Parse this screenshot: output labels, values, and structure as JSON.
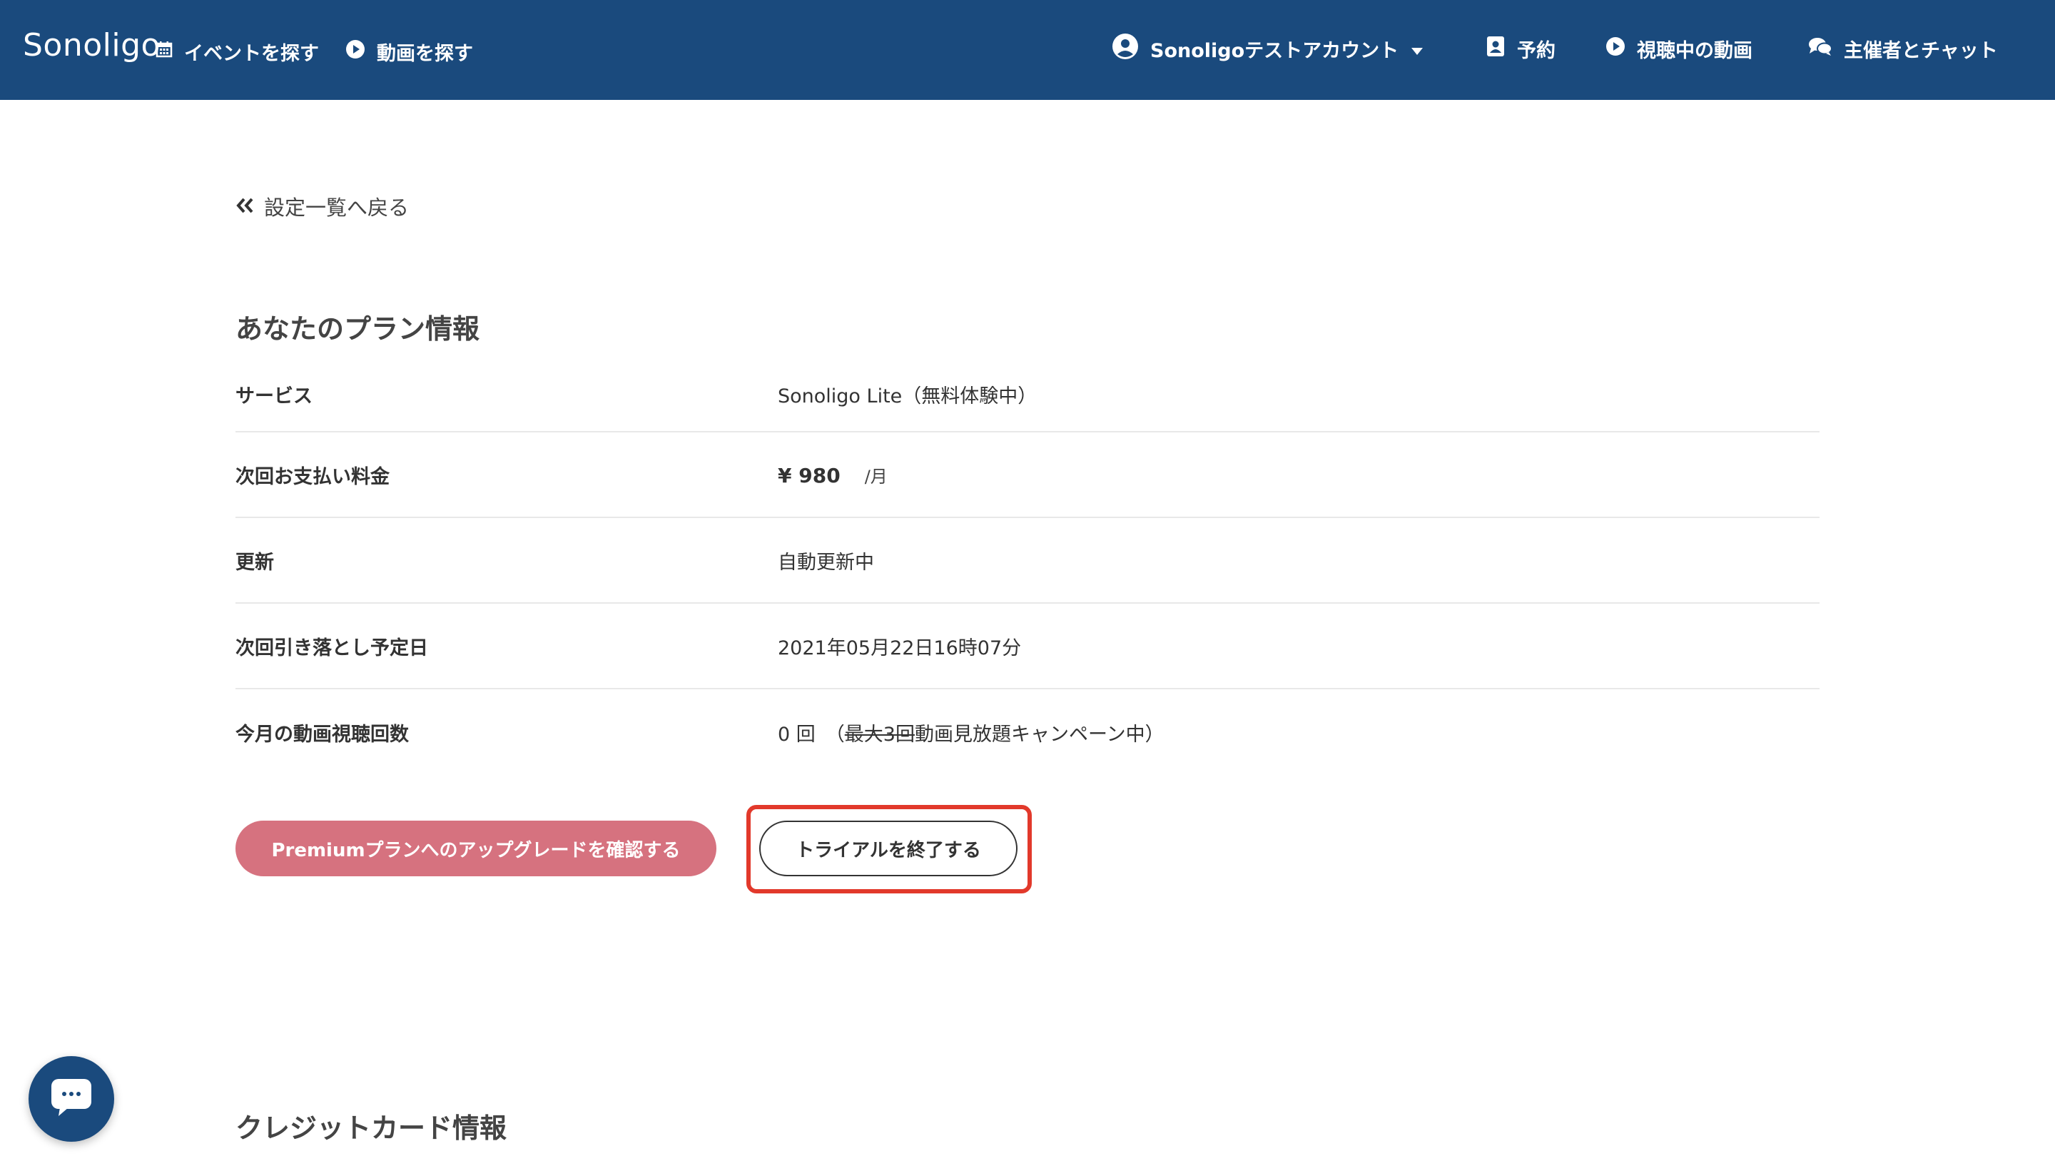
{
  "header": {
    "logo": "Sonoligo",
    "nav_left": [
      {
        "label": "イベントを探す",
        "icon": "calendar-icon"
      },
      {
        "label": "動画を探す",
        "icon": "play-circle-icon"
      }
    ],
    "account": {
      "label": "Sonoligoテストアカウント",
      "icon": "user-circle-icon",
      "caret": "caret-down-icon"
    },
    "nav_right": [
      {
        "label": "予約",
        "icon": "contact-book-icon"
      },
      {
        "label": "視聴中の動画",
        "icon": "play-circle-icon"
      },
      {
        "label": "主催者とチャット",
        "icon": "chat-bubbles-icon"
      }
    ]
  },
  "back_link": {
    "label": "設定一覧へ戻る",
    "icon": "double-chevron-left-icon"
  },
  "plan": {
    "title": "あなたのプラン情報",
    "rows": [
      {
        "label": "サービス",
        "value": "Sonoligo Lite（無料体験中）"
      },
      {
        "label": "次回お支払い料金",
        "price": "¥ 980",
        "per": "/月"
      },
      {
        "label": "更新",
        "value": "自動更新中"
      },
      {
        "label": "次回引き落とし予定日",
        "value": "2021年05月22日16時07分"
      },
      {
        "label": "今月の動画視聴回数",
        "count": "0 回",
        "paren_open": "（",
        "strike": "最大3回",
        "campaign": " 動画見放題キャンペーン中）"
      }
    ],
    "upgrade_button": "Premiumプランへのアップグレードを確認する",
    "end_trial_button": "トライアルを終了する"
  },
  "card": {
    "title": "クレジットカード情報"
  },
  "colors": {
    "header_bg": "#1a4a7d",
    "upgrade_bg": "#d6727f",
    "highlight": "#e2392b"
  }
}
